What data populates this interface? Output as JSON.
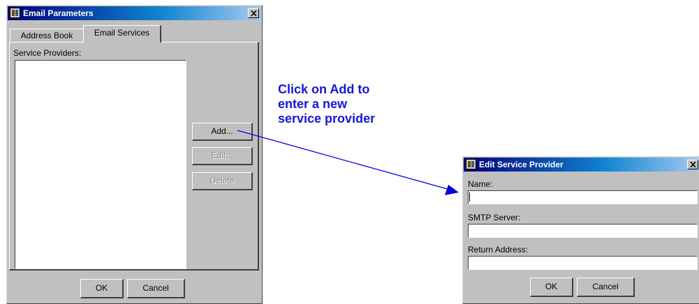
{
  "main_dialog": {
    "title": "Email Parameters",
    "tabs": [
      {
        "label": "Address Book",
        "active": false
      },
      {
        "label": "Email Services",
        "active": true
      }
    ],
    "list_label": "Service Providers:",
    "buttons": {
      "add": "Add...",
      "edit": "Edit...",
      "delete": "Delete",
      "ok": "OK",
      "cancel": "Cancel"
    }
  },
  "callout": {
    "text": "Click on Add to\nenter a new\nservice provider",
    "color": "#1515d8"
  },
  "edit_dialog": {
    "title": "Edit Service Provider",
    "fields": [
      {
        "label": "Name:",
        "value": ""
      },
      {
        "label": "SMTP Server:",
        "value": ""
      },
      {
        "label": "Return Address:",
        "value": ""
      }
    ],
    "buttons": {
      "ok": "OK",
      "cancel": "Cancel"
    }
  },
  "icons": {
    "app": "app-icon",
    "close": "close-icon"
  }
}
